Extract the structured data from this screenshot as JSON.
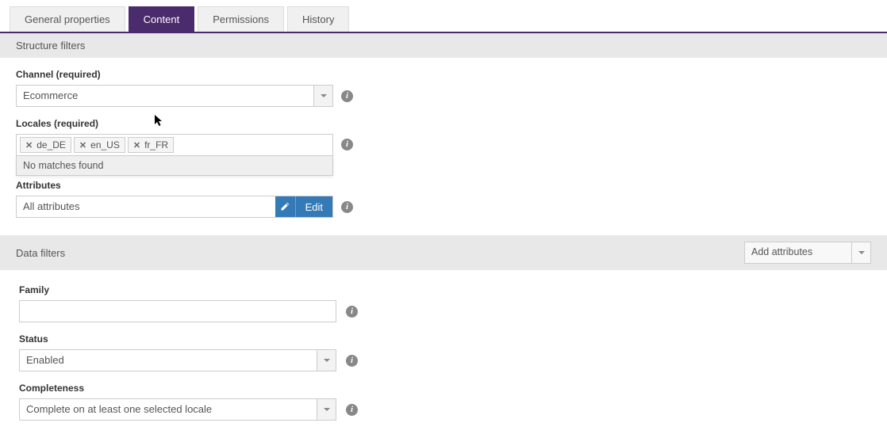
{
  "tabs": {
    "general_properties": "General properties",
    "content": "Content",
    "permissions": "Permissions",
    "history": "History"
  },
  "sections": {
    "structure_filters": "Structure filters",
    "data_filters": "Data filters"
  },
  "channel": {
    "label": "Channel (required)",
    "value": "Ecommerce"
  },
  "locales": {
    "label": "Locales (required)",
    "tags": [
      "de_DE",
      "en_US",
      "fr_FR"
    ],
    "no_matches": "No matches found"
  },
  "attributes": {
    "label": "Attributes",
    "value": "All attributes",
    "edit_label": "Edit"
  },
  "add_attributes": {
    "label": "Add attributes"
  },
  "family": {
    "label": "Family",
    "value": ""
  },
  "status": {
    "label": "Status",
    "value": "Enabled"
  },
  "completeness": {
    "label": "Completeness",
    "value": "Complete on at least one selected locale"
  }
}
